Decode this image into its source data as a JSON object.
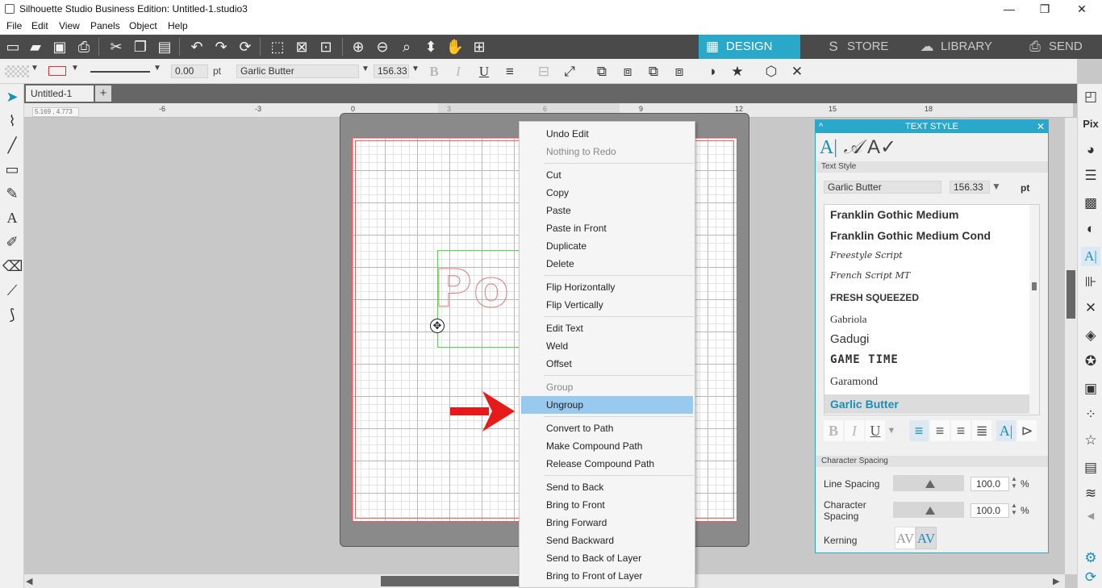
{
  "window": {
    "title": "Silhouette Studio Business Edition: Untitled-1.studio3",
    "minimize": "—",
    "restore": "❐",
    "close": "✕"
  },
  "menu": [
    "File",
    "Edit",
    "View",
    "Panels",
    "Object",
    "Help"
  ],
  "toolbar_icons": [
    "new-icon",
    "open-icon",
    "save-icon",
    "print-icon",
    "cut-icon",
    "copy-icon",
    "paste-icon",
    "undo-icon",
    "redo-icon",
    "redraw-icon",
    "select-all-icon",
    "deselect-icon",
    "edit-points-icon",
    "zoom-in-icon",
    "zoom-out-icon",
    "zoom-select-icon",
    "pan-drag-icon",
    "hand-icon",
    "fit-page-icon"
  ],
  "tabs": [
    {
      "label": "DESIGN",
      "icon": "grid-icon",
      "active": true
    },
    {
      "label": "STORE",
      "icon": "store-icon",
      "active": false
    },
    {
      "label": "LIBRARY",
      "icon": "cloud-icon",
      "active": false
    },
    {
      "label": "SEND",
      "icon": "send-icon",
      "active": false
    }
  ],
  "propbar": {
    "line_width": "0.00",
    "line_unit": "pt",
    "font_name": "Garlic Butter",
    "font_size": "156.33"
  },
  "doc_tab": {
    "label": "Untitled-1",
    "add": "+"
  },
  "ruler": {
    "ticks": [
      "-6",
      "-3",
      "0",
      "3",
      "6",
      "9",
      "12",
      "15",
      "18"
    ],
    "coords": "5.169 , 4.773"
  },
  "canvas": {
    "design_text": "Po"
  },
  "context_menu": {
    "items": [
      {
        "label": "Undo Edit",
        "enabled": true
      },
      {
        "label": "Nothing to Redo",
        "enabled": false
      },
      {
        "sep": true
      },
      {
        "label": "Cut",
        "enabled": true
      },
      {
        "label": "Copy",
        "enabled": true
      },
      {
        "label": "Paste",
        "enabled": true
      },
      {
        "label": "Paste in Front",
        "enabled": true
      },
      {
        "label": "Duplicate",
        "enabled": true
      },
      {
        "label": "Delete",
        "enabled": true
      },
      {
        "sep": true
      },
      {
        "label": "Flip Horizontally",
        "enabled": true
      },
      {
        "label": "Flip Vertically",
        "enabled": true
      },
      {
        "sep": true
      },
      {
        "label": "Edit Text",
        "enabled": true
      },
      {
        "label": "Weld",
        "enabled": true
      },
      {
        "label": "Offset",
        "enabled": true
      },
      {
        "sep": true
      },
      {
        "label": "Group",
        "enabled": false
      },
      {
        "label": "Ungroup",
        "enabled": true,
        "highlighted": true
      },
      {
        "sep": true
      },
      {
        "label": "Convert to Path",
        "enabled": true
      },
      {
        "label": "Make Compound Path",
        "enabled": true
      },
      {
        "label": "Release Compound Path",
        "enabled": true
      },
      {
        "sep": true
      },
      {
        "label": "Send to Back",
        "enabled": true
      },
      {
        "label": "Bring to Front",
        "enabled": true
      },
      {
        "label": "Bring Forward",
        "enabled": true
      },
      {
        "label": "Send Backward",
        "enabled": true
      },
      {
        "label": "Send to Back of Layer",
        "enabled": true
      },
      {
        "label": "Bring to Front of Layer",
        "enabled": true
      }
    ]
  },
  "text_style": {
    "title": "TEXT STYLE",
    "section_text_style": "Text Style",
    "font_name": "Garlic Butter",
    "font_size": "156.33",
    "size_unit": "pt",
    "fonts": [
      {
        "name": "Franklin Gothic Medium",
        "selected": false
      },
      {
        "name": "Franklin Gothic Medium Cond",
        "selected": false
      },
      {
        "name": "Freestyle Script",
        "selected": false
      },
      {
        "name": "French Script MT",
        "selected": false
      },
      {
        "name": "FRESH SQUEEZED",
        "selected": false
      },
      {
        "name": "Gabriola",
        "selected": false
      },
      {
        "name": "Gadugi",
        "selected": false
      },
      {
        "name": "GAME TIME",
        "selected": false
      },
      {
        "name": "Garamond",
        "selected": false
      },
      {
        "name": "Garlic Butter",
        "selected": true
      }
    ],
    "section_spacing": "Character Spacing",
    "line_spacing_label": "Line Spacing",
    "line_spacing_value": "100.0",
    "char_spacing_label_1": "Character",
    "char_spacing_label_2": "Spacing",
    "char_spacing_value": "100.0",
    "percent": "%",
    "kerning_label": "Kerning",
    "kerning_glyph_1": "AV",
    "kerning_glyph_2": "AV"
  },
  "colors": {
    "accent": "#29a8c9",
    "toolbar_bg": "#4a4a4a",
    "menu_highlight": "#99c9ef",
    "arrow_red": "#e81919"
  }
}
